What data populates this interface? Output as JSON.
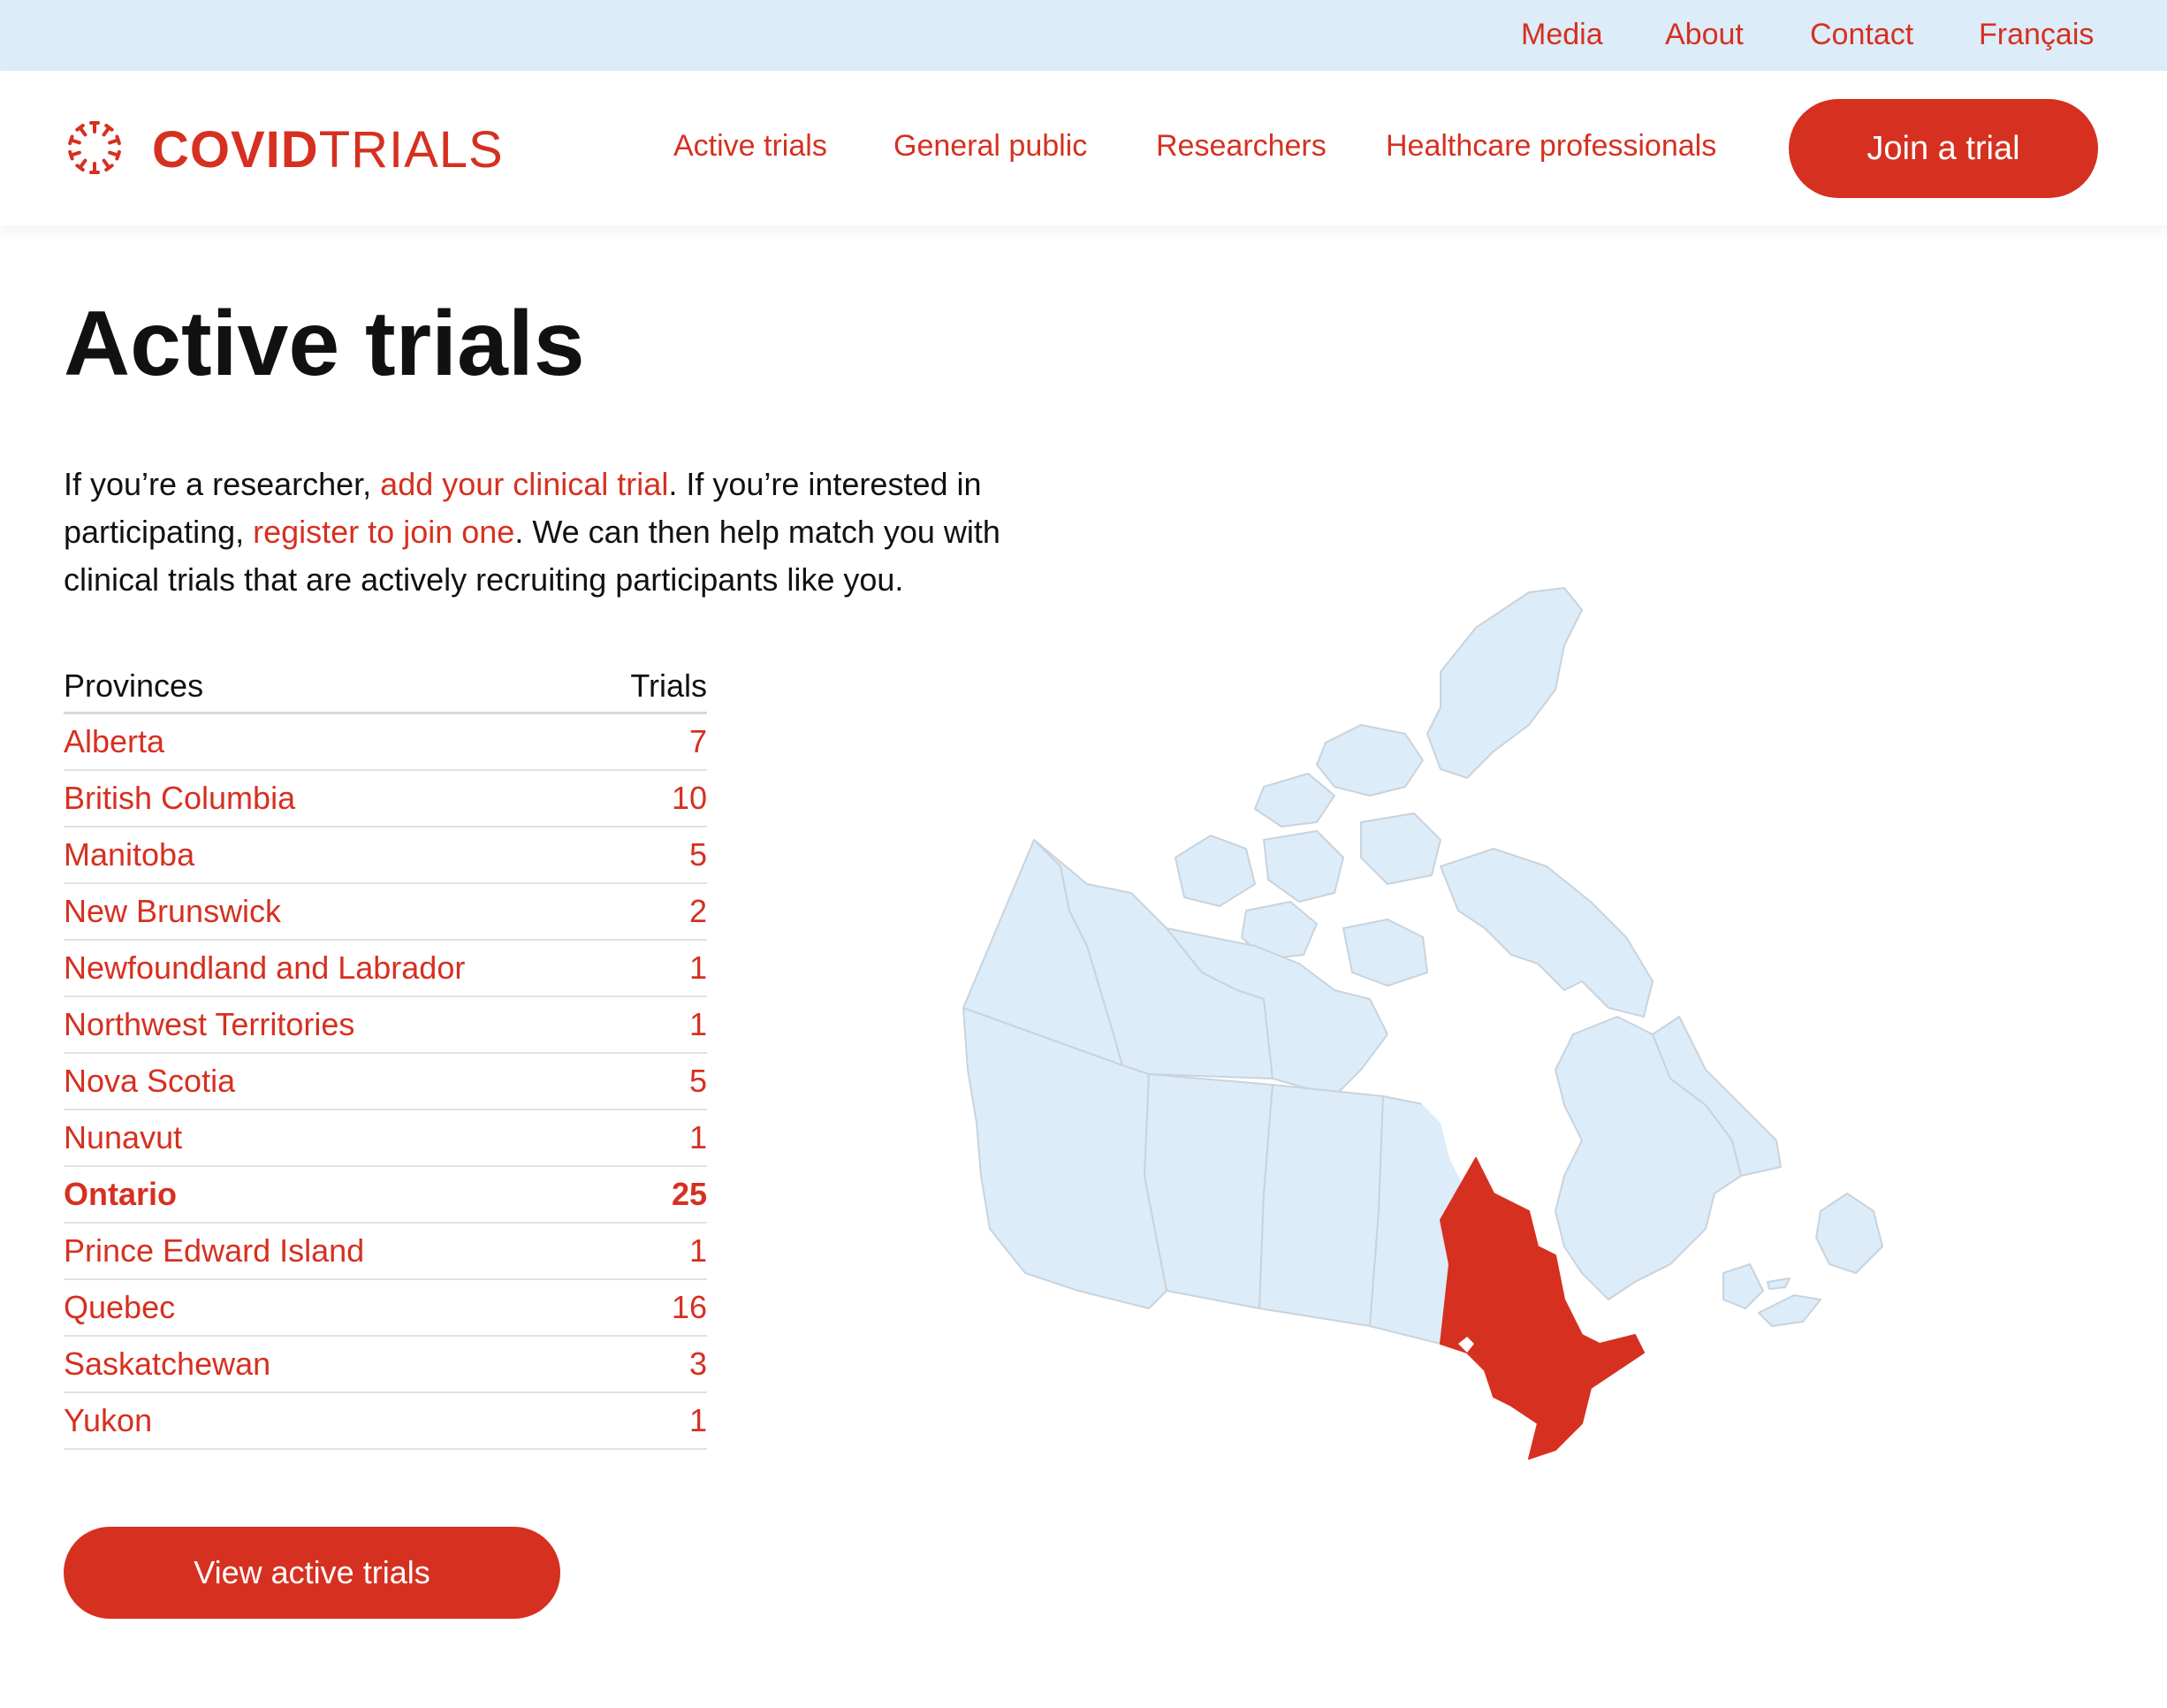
{
  "topbar": {
    "links": [
      "Media",
      "About",
      "Contact",
      "Français"
    ]
  },
  "brand": {
    "name_bold": "COVID",
    "name_light": "TRIALS"
  },
  "nav": {
    "items": [
      "Active trials",
      "General public",
      "Researchers",
      "Healthcare professionals"
    ],
    "cta": "Join a trial"
  },
  "page": {
    "title": "Active trials",
    "intro": {
      "p1": "If you’re a researcher, ",
      "link1": "add your clinical trial",
      "p2": ". If you’re interested in participating, ",
      "link2": "register to join one",
      "p3": ". We can then help match you with clinical trials that are actively recruiting participants like you."
    }
  },
  "table": {
    "headers": [
      "Provinces",
      "Trials"
    ],
    "rows": [
      {
        "province": "Alberta",
        "trials": "7"
      },
      {
        "province": "British Columbia",
        "trials": "10"
      },
      {
        "province": "Manitoba",
        "trials": "5"
      },
      {
        "province": "New Brunswick",
        "trials": "2"
      },
      {
        "province": "Newfoundland and Labrador",
        "trials": "1"
      },
      {
        "province": "Northwest Territories",
        "trials": "1"
      },
      {
        "province": "Nova Scotia",
        "trials": "5"
      },
      {
        "province": "Nunavut",
        "trials": "1"
      },
      {
        "province": "Ontario",
        "trials": "25"
      },
      {
        "province": "Prince Edward Island",
        "trials": "1"
      },
      {
        "province": "Quebec",
        "trials": "16"
      },
      {
        "province": "Saskatchewan",
        "trials": "3"
      },
      {
        "province": "Yukon",
        "trials": "1"
      }
    ],
    "highlighted": "Ontario"
  },
  "cta": {
    "view_trials": "View active trials"
  },
  "map": {
    "highlight_region": "Ontario"
  },
  "colors": {
    "accent": "#d63020",
    "topbar_bg": "#dcecf8",
    "map_land": "#dcecf8",
    "map_border": "#c9d3dc"
  }
}
